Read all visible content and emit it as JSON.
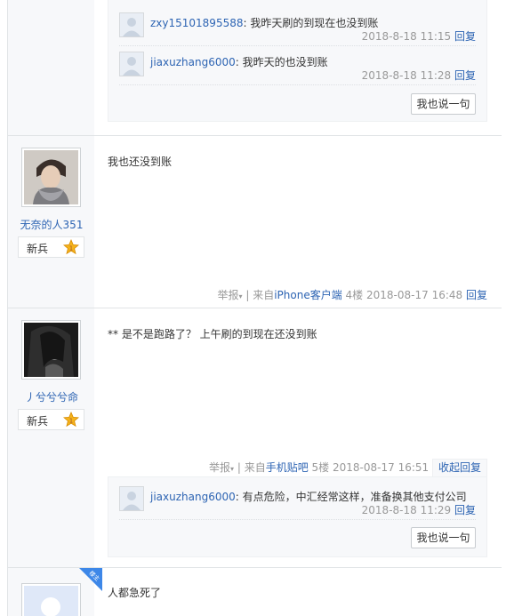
{
  "top_lzl": {
    "replies": [
      {
        "user": "zxy15101895588",
        "text": ": 我昨天刷的到现在也没到账",
        "time": "2018-8-18 11:15",
        "reply_label": "回复"
      },
      {
        "user": "jiaxuzhang6000",
        "text": ": 我昨天的也没到账",
        "time": "2018-8-18 11:28",
        "reply_label": "回复"
      }
    ],
    "say_button": "我也说一句"
  },
  "post4": {
    "username": "无奈的人351",
    "rank": "新兵",
    "content": "我也还没到账",
    "report": "举报",
    "source_prefix": "来自",
    "source": "iPhone客户端",
    "floor": "4楼",
    "date": "2018-08-17 16:48",
    "reply": "回复"
  },
  "post5": {
    "username": "丿兮兮兮命",
    "rank": "新兵",
    "content": "** 是不是跑路了？ 上午刷的到现在还没到账",
    "report": "举报",
    "source_prefix": "来自",
    "source": "手机贴吧",
    "floor": "5楼",
    "date": "2018-08-17 16:51",
    "collapse": "收起回复",
    "lzl": {
      "replies": [
        {
          "user": "jiaxuzhang6000",
          "text": ": 有点危险，中汇经常这样，准备换其他支付公司",
          "time": "2018-8-18 11:29",
          "reply_label": "回复"
        }
      ],
      "say_button": "我也说一句"
    }
  },
  "post6": {
    "badge": "楼主",
    "content": "人都急死了"
  },
  "colors": {
    "link": "#2d64b3",
    "meta": "#999999",
    "sidebar": "#f7f8fa",
    "badge": "#3d87e8"
  }
}
